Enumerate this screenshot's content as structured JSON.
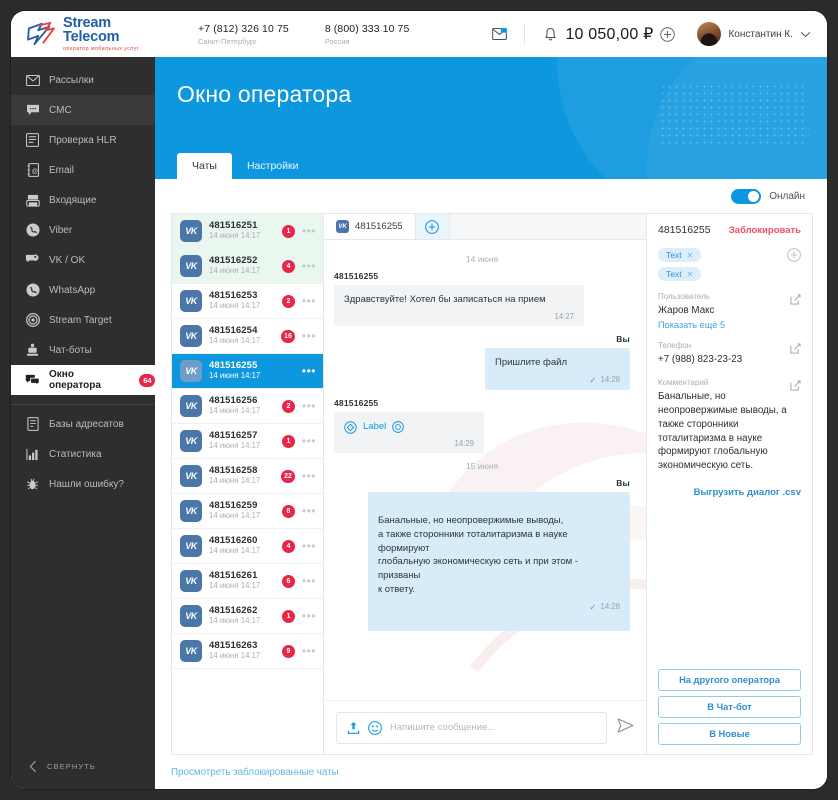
{
  "brand": {
    "name": "Stream Telecom",
    "tagline": "оператор мобильных услуг"
  },
  "header": {
    "phones": [
      {
        "number": "+7 (812) 326 10 75",
        "region": "Санкт-Петербург"
      },
      {
        "number": "8 (800) 333 10 75",
        "region": "Россия"
      }
    ],
    "mail_icon": "mail-icon",
    "bell_icon": "bell-icon",
    "balance": "10 050,00 ₽",
    "add_funds_icon": "plus-circle-icon",
    "user_name": "Константин К.",
    "chevron_icon": "chevron-down-icon"
  },
  "sidebar": {
    "items": [
      {
        "label": "Рассылки",
        "icon": "envelope-icon",
        "state": "normal"
      },
      {
        "label": "СМС",
        "icon": "chat-bubble-icon",
        "state": "hover"
      },
      {
        "label": "Проверка HLR",
        "icon": "list-check-icon",
        "state": "normal"
      },
      {
        "label": "Email",
        "icon": "email-book-icon",
        "state": "normal"
      },
      {
        "label": "Входящие",
        "icon": "inbox-icon",
        "state": "normal"
      },
      {
        "label": "Viber",
        "icon": "viber-icon",
        "state": "normal"
      },
      {
        "label": "VK / OK",
        "icon": "vk-ok-icon",
        "state": "normal"
      },
      {
        "label": "WhatsApp",
        "icon": "whatsapp-icon",
        "state": "normal"
      },
      {
        "label": "Stream Target",
        "icon": "target-icon",
        "state": "normal"
      },
      {
        "label": "Чат-боты",
        "icon": "robot-icon",
        "state": "normal"
      },
      {
        "label": "Окно оператора",
        "icon": "operator-chat-icon",
        "state": "active",
        "badge": "64"
      }
    ],
    "items_secondary": [
      {
        "label": "Базы адресатов",
        "icon": "database-icon"
      },
      {
        "label": "Статистика",
        "icon": "bar-chart-icon"
      },
      {
        "label": "Нашли ошибку?",
        "icon": "bug-icon"
      }
    ],
    "collapse_label": "СВЕРНУТЬ",
    "collapse_icon": "chevron-left-icon"
  },
  "page": {
    "title": "Окно оператора",
    "tabs": [
      {
        "label": "Чаты",
        "active": true
      },
      {
        "label": "Настройки",
        "active": false
      }
    ],
    "online_label": "Онлайн",
    "online_on": true,
    "footer_link": "Просмотреть заблокированные чаты"
  },
  "chat_list": [
    {
      "name": "481516251",
      "time": "14 июня 14:17",
      "badge": "1",
      "bg": "unread",
      "selected": false
    },
    {
      "name": "481516252",
      "time": "14 июня 14:17",
      "badge": "4",
      "bg": "unread",
      "selected": false
    },
    {
      "name": "481516253",
      "time": "14 июня 14:17",
      "badge": "2",
      "bg": "plain",
      "selected": false
    },
    {
      "name": "481516254",
      "time": "14 июня 14:17",
      "badge": "16",
      "bg": "plain",
      "selected": false
    },
    {
      "name": "481516255",
      "time": "14 июня 14:17",
      "badge": "",
      "bg": "plain",
      "selected": true
    },
    {
      "name": "481516256",
      "time": "14 июня 14:17",
      "badge": "2",
      "bg": "plain",
      "selected": false
    },
    {
      "name": "481516257",
      "time": "14 июня 14:17",
      "badge": "1",
      "bg": "plain",
      "selected": false
    },
    {
      "name": "481516258",
      "time": "14 июня 14:17",
      "badge": "22",
      "bg": "plain",
      "selected": false
    },
    {
      "name": "481516259",
      "time": "14 июня 14:17",
      "badge": "8",
      "bg": "plain",
      "selected": false
    },
    {
      "name": "481516260",
      "time": "14 июня 14:17",
      "badge": "4",
      "bg": "plain",
      "selected": false
    },
    {
      "name": "481516261",
      "time": "14 июня 14:17",
      "badge": "6",
      "bg": "plain",
      "selected": false
    },
    {
      "name": "481516262",
      "time": "14 июня 14:17",
      "badge": "1",
      "bg": "plain",
      "selected": false
    },
    {
      "name": "481516263",
      "time": "14 июня 14:17",
      "badge": "9",
      "bg": "plain",
      "selected": false
    }
  ],
  "conversation": {
    "tab_label": "481516255",
    "tab_icon": "vk-icon",
    "add_tab_icon": "plus-circle-icon",
    "days": [
      {
        "date": "14 июня",
        "messages": [
          {
            "author": "481516255",
            "side": "in",
            "text": "Здравствуйте! Хотел бы записаться на прием",
            "time": "14:27",
            "read": false
          },
          {
            "author": "Вы",
            "side": "out",
            "text": "Пришлите файл",
            "time": "14:28",
            "read": true
          },
          {
            "author": "481516255",
            "side": "in",
            "type": "attachment",
            "label": "Label",
            "time": "14:29",
            "read": false
          }
        ]
      },
      {
        "date": "15 июня",
        "messages": [
          {
            "author": "Вы",
            "side": "out",
            "text": "Банальные, но неопровержимые выводы,\nа также сторонники тоталитаризма в науке формируют\nглобальную экономическую сеть и при этом - призваны\nк ответу.",
            "time": "14:28",
            "read": true
          }
        ]
      }
    ],
    "composer": {
      "attach_icon": "upload-icon",
      "emoji_icon": "smiley-icon",
      "placeholder": "Напишите сообщение...",
      "value": "",
      "send_icon": "send-icon"
    }
  },
  "info_panel": {
    "id": "481516255",
    "block_label": "Заблокировать",
    "tags": [
      "Text",
      "Text"
    ],
    "tag_add_icon": "plus-circle-icon",
    "fields": [
      {
        "label": "Пользователь",
        "value": "Жаров Макс",
        "link": "Показать ещё 5",
        "edit_icon": "edit-icon"
      },
      {
        "label": "Телефон",
        "value": "+7 (988) 823-23-23",
        "edit_icon": "edit-icon"
      },
      {
        "label": "Комментарий",
        "value": "Банальные, но неопровержимые выводы, а также сторонники тоталитаризма в науке формируют глобальную экономическую сеть.",
        "edit_icon": "edit-icon"
      }
    ],
    "export_link": "Выгрузить диалог .csv",
    "actions": [
      "На другого оператора",
      "В Чат-бот",
      "В Новые"
    ]
  },
  "colors": {
    "accent": "#0d97de",
    "brand_blue": "#1e5fa8",
    "brand_red": "#e8413f",
    "badge_red": "#e8264a",
    "sidebar_bg": "#2e2e2e",
    "out_bubble": "#d7ecf8",
    "in_bubble": "#f2f3f4",
    "unread_row": "#eaf7ee"
  }
}
